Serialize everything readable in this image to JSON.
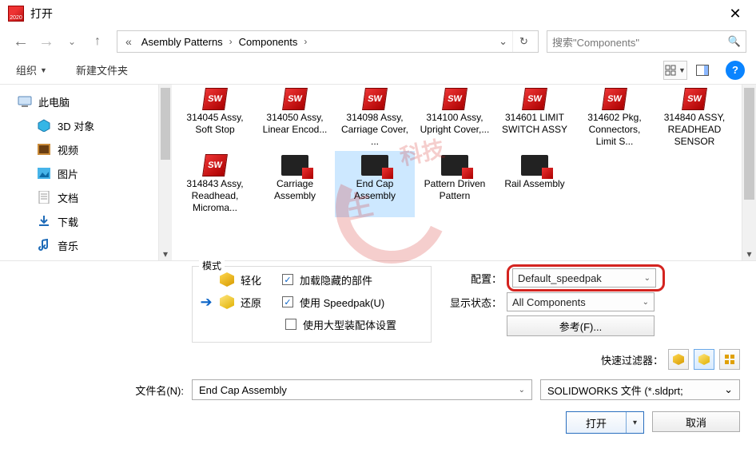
{
  "window": {
    "title": "打开"
  },
  "addr": {
    "seg1": "Asembly Patterns",
    "seg2": "Components",
    "search_placeholder": "搜索\"Components\""
  },
  "toolbar": {
    "organize": "组织",
    "newfolder": "新建文件夹"
  },
  "sidebar": {
    "thispc": "此电脑",
    "items": [
      {
        "label": "3D 对象"
      },
      {
        "label": "视频"
      },
      {
        "label": "图片"
      },
      {
        "label": "文档"
      },
      {
        "label": "下载"
      },
      {
        "label": "音乐"
      }
    ]
  },
  "files_row1": [
    {
      "name": "314045 Assy, Soft Stop",
      "kind": "sw"
    },
    {
      "name": "314050 Assy, Linear Encod...",
      "kind": "sw"
    },
    {
      "name": "314098 Assy, Carriage Cover, ...",
      "kind": "sw"
    },
    {
      "name": "314100 Assy, Upright Cover,...",
      "kind": "sw"
    },
    {
      "name": "314601 LIMIT SWITCH ASSY",
      "kind": "sw"
    },
    {
      "name": "314602 Pkg, Connectors, Limit S...",
      "kind": "sw"
    },
    {
      "name": "314840 ASSY, READHEAD SENSOR",
      "kind": "sw"
    }
  ],
  "files_row2": [
    {
      "name": "314843 Assy, Readhead, Microma...",
      "kind": "sw"
    },
    {
      "name": "Carriage Assembly",
      "kind": "dark"
    },
    {
      "name": "End Cap Assembly",
      "kind": "dark",
      "selected": true
    },
    {
      "name": "Pattern Driven Pattern",
      "kind": "dark"
    },
    {
      "name": "Rail Assembly",
      "kind": "dark"
    }
  ],
  "mode": {
    "legend": "模式",
    "light": "轻化",
    "restore": "还原",
    "chk_hidden": "加载隐藏的部件",
    "chk_speedpak": "使用 Speedpak(U)",
    "chk_large": "使用大型装配体设置"
  },
  "config": {
    "cfg_label": "配置：",
    "cfg_value": "Default_speedpak",
    "disp_label": "显示状态：",
    "disp_value": "All Components",
    "refs": "参考(F)..."
  },
  "quickfilter": {
    "label": "快速过滤器："
  },
  "filename": {
    "label": "文件名(N):",
    "value": "End Cap Assembly",
    "filetype": "SOLIDWORKS 文件 (*.sldprt;"
  },
  "buttons": {
    "open": "打开",
    "cancel": "取消"
  }
}
